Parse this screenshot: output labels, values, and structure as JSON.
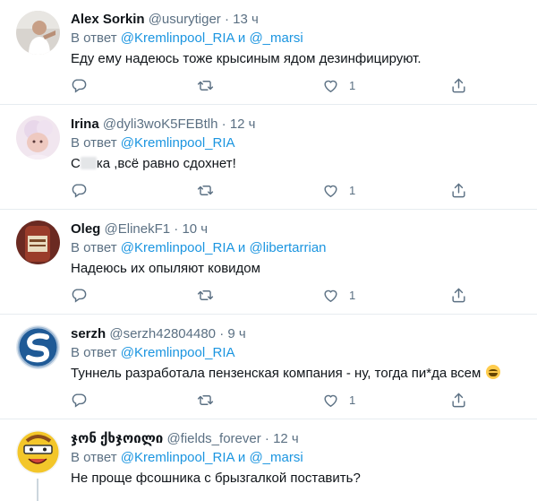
{
  "tweets": [
    {
      "name": "Alex Sorkin",
      "handle": "@usurytiger",
      "time": "13 ч",
      "replying_prefix": "В ответ",
      "mention1": "@Kremlinpool_RIA",
      "conj": "и",
      "mention2": "@_marsi",
      "text": "Еду ему надеюсь тоже крысиным ядом дезинфицируют.",
      "likes": "1"
    },
    {
      "name": "Irina",
      "handle": "@dyli3woK5FEBtlh",
      "time": "12 ч",
      "replying_prefix": "В ответ",
      "mention1": "@Kremlinpool_RIA",
      "text_start": "С",
      "text": "ка ,всё равно сдохнет!",
      "likes": "1"
    },
    {
      "name": "Oleg",
      "handle": "@ElinekF1",
      "time": "10 ч",
      "replying_prefix": "В ответ",
      "mention1": "@Kremlinpool_RIA",
      "conj": "и",
      "mention2": "@libertarrian",
      "text": "Надеюсь их опыляют ковидом",
      "likes": "1"
    },
    {
      "name": "serzh",
      "handle": "@serzh42804480",
      "time": "9 ч",
      "replying_prefix": "В ответ",
      "mention1": "@Kremlinpool_RIA",
      "text": "Туннель разработала пензенская компания - ну, тогда пи*да всем",
      "likes": "1"
    },
    {
      "name": "ჯონ ქხჯოილი",
      "handle": "@fields_forever",
      "time": "12 ч",
      "replying_prefix": "В ответ",
      "mention1": "@Kremlinpool_RIA",
      "conj": "и",
      "mention2": "@_marsi",
      "text": "Не проще фсошника с брызгалкой поставить?"
    }
  ],
  "dot": "·",
  "colors": {
    "link": "#1b95e0",
    "muted": "#5b7083",
    "text": "#0f1419",
    "border": "#e6ecf0"
  },
  "icons": [
    "reply-icon",
    "retweet-icon",
    "like-icon",
    "share-icon"
  ]
}
